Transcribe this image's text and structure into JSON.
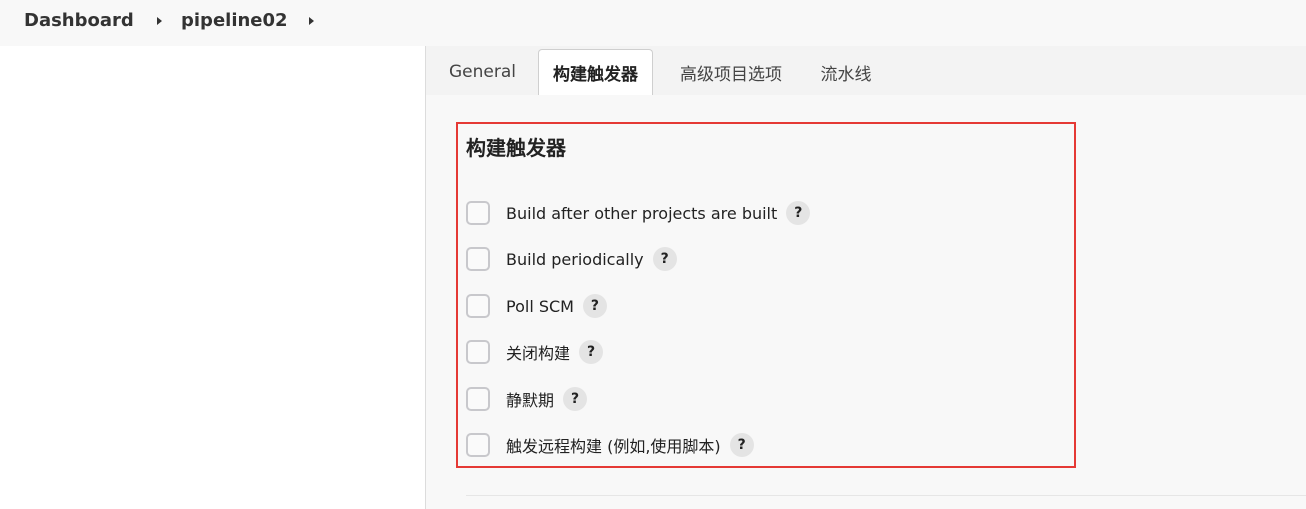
{
  "breadcrumb": {
    "dashboard": "Dashboard",
    "project": "pipeline02"
  },
  "tabs": [
    {
      "label": "General",
      "active": false
    },
    {
      "label": "构建触发器",
      "active": true
    },
    {
      "label": "高级项目选项",
      "active": false
    },
    {
      "label": "流水线",
      "active": false
    }
  ],
  "section": {
    "title": "构建触发器",
    "help_glyph": "?",
    "options": [
      {
        "label": "Build after other projects are built",
        "checked": false
      },
      {
        "label": "Build periodically",
        "checked": false
      },
      {
        "label": "Poll SCM",
        "checked": false
      },
      {
        "label": "关闭构建",
        "checked": false
      },
      {
        "label": "静默期",
        "checked": false
      },
      {
        "label": "触发远程构建 (例如,使用脚本)",
        "checked": false
      }
    ]
  },
  "colors": {
    "highlight_border": "#e53935",
    "tab_bar_bg": "#f3f3f3",
    "main_bg": "#f8f8f8",
    "help_bg": "#e4e4e4"
  },
  "icons": {
    "breadcrumb_separator": "chevron-right-icon",
    "help": "question-mark-icon"
  }
}
